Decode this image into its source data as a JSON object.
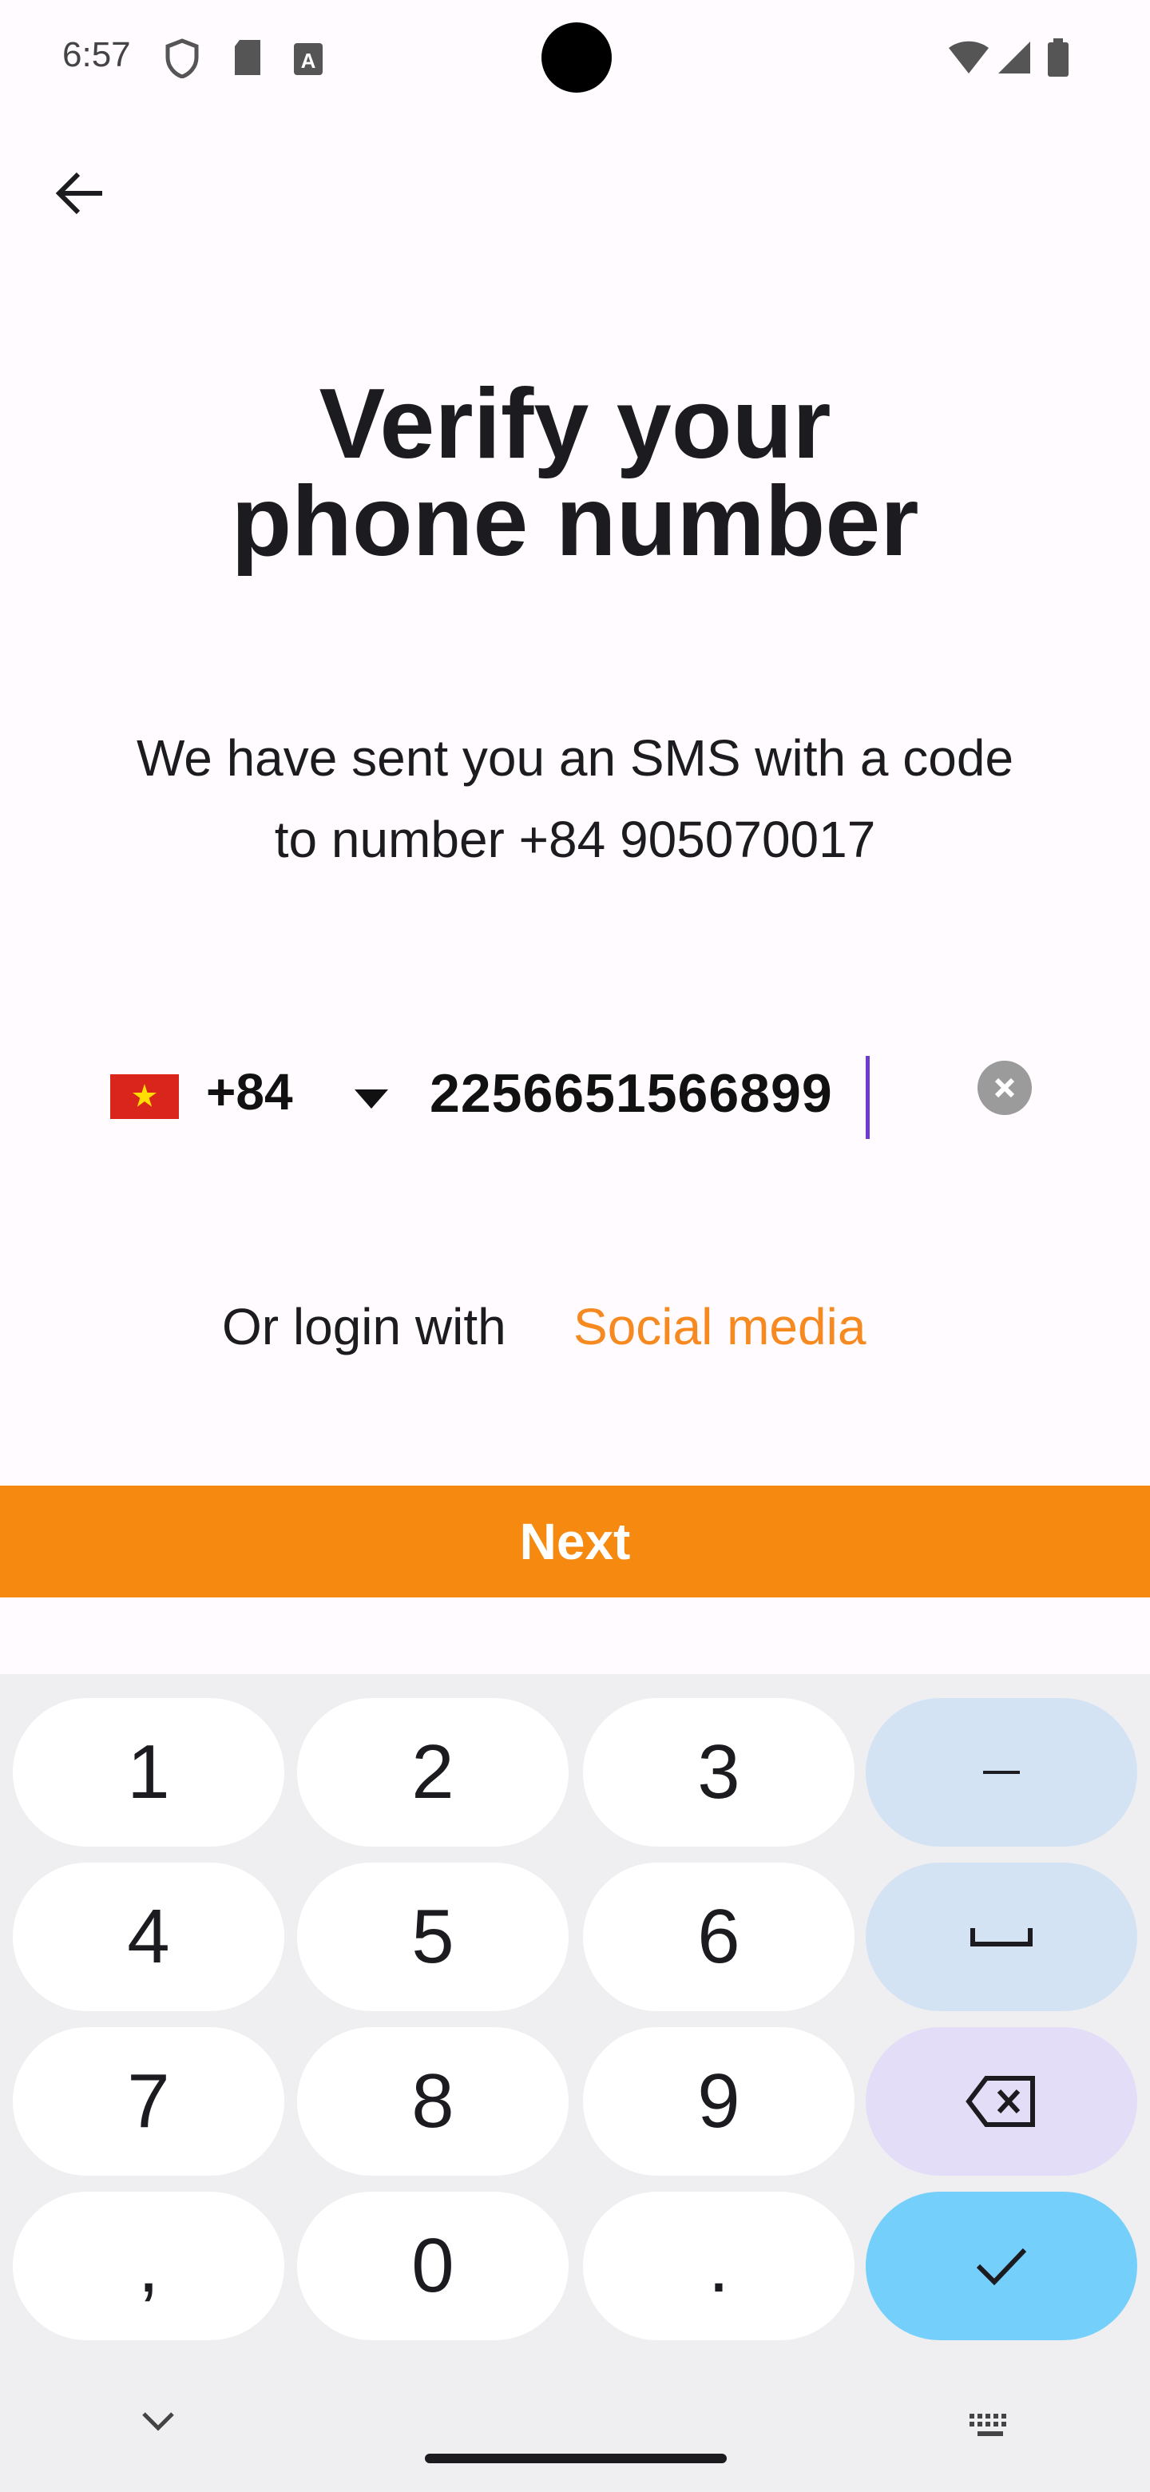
{
  "status_bar": {
    "time": "6:57"
  },
  "header": {
    "title_line1": "Verify your",
    "title_line2": "phone number"
  },
  "message": {
    "line1": "We have sent you an SMS with a code",
    "line2": "to number +84 905070017"
  },
  "phone_input": {
    "country_code": "+84",
    "value": "2256651566899"
  },
  "social": {
    "prefix": "Or login with",
    "link": "Social media"
  },
  "actions": {
    "next": "Next"
  },
  "keyboard": {
    "rows": [
      [
        "1",
        "2",
        "3",
        "–"
      ],
      [
        "4",
        "5",
        "6",
        "␣"
      ],
      [
        "7",
        "8",
        "9",
        "⌫"
      ],
      [
        ",",
        "0",
        ".",
        "✓"
      ]
    ]
  },
  "colors": {
    "accent": "#f6890f",
    "link": "#f6891f"
  }
}
